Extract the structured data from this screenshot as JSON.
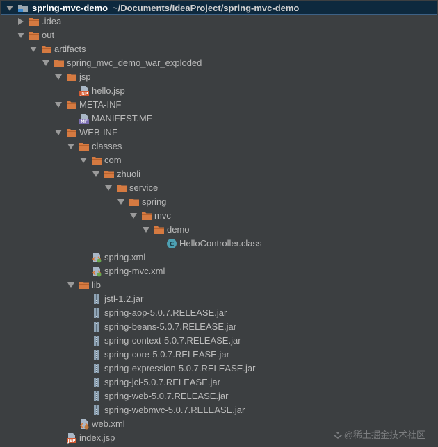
{
  "window_title": "spring-mvc-demo",
  "project_path": "~/Documents/IdeaProject/spring-mvc-demo",
  "watermark": "@稀土掘金技术社区",
  "colors": {
    "background": "#3c3f41",
    "selection": "#0d293e",
    "folder": "#d57a41",
    "jar": "#8fa3b4",
    "class": "#4da0b2",
    "text": "#bbbbbb"
  },
  "tree": [
    {
      "label": ".idea",
      "icon": "folder-icon",
      "toggle": "closed",
      "depth": 1
    },
    {
      "label": "out",
      "icon": "folder-icon",
      "toggle": "open",
      "depth": 1
    },
    {
      "label": "artifacts",
      "icon": "folder-icon",
      "toggle": "open",
      "depth": 2
    },
    {
      "label": "spring_mvc_demo_war_exploded",
      "icon": "folder-icon",
      "toggle": "open",
      "depth": 3
    },
    {
      "label": "jsp",
      "icon": "folder-icon",
      "toggle": "open",
      "depth": 4
    },
    {
      "label": "hello.jsp",
      "icon": "jsp-file-icon",
      "toggle": "none",
      "depth": 5
    },
    {
      "label": "META-INF",
      "icon": "folder-icon",
      "toggle": "open",
      "depth": 4
    },
    {
      "label": "MANIFEST.MF",
      "icon": "manifest-file-icon",
      "toggle": "none",
      "depth": 5
    },
    {
      "label": "WEB-INF",
      "icon": "folder-icon",
      "toggle": "open",
      "depth": 4
    },
    {
      "label": "classes",
      "icon": "folder-icon",
      "toggle": "open",
      "depth": 5
    },
    {
      "label": "com",
      "icon": "folder-icon",
      "toggle": "open",
      "depth": 6
    },
    {
      "label": "zhuoli",
      "icon": "folder-icon",
      "toggle": "open",
      "depth": 7
    },
    {
      "label": "service",
      "icon": "folder-icon",
      "toggle": "open",
      "depth": 8
    },
    {
      "label": "spring",
      "icon": "folder-icon",
      "toggle": "open",
      "depth": 9
    },
    {
      "label": "mvc",
      "icon": "folder-icon",
      "toggle": "open",
      "depth": 10
    },
    {
      "label": "demo",
      "icon": "folder-icon",
      "toggle": "open",
      "depth": 11
    },
    {
      "label": "HelloController.class",
      "icon": "java-class-icon",
      "toggle": "none",
      "depth": 12
    },
    {
      "label": "spring.xml",
      "icon": "spring-xml-icon",
      "toggle": "none",
      "depth": 6
    },
    {
      "label": "spring-mvc.xml",
      "icon": "spring-xml-icon",
      "toggle": "none",
      "depth": 6
    },
    {
      "label": "lib",
      "icon": "folder-icon",
      "toggle": "open",
      "depth": 5
    },
    {
      "label": "jstl-1.2.jar",
      "icon": "jar-icon",
      "toggle": "none",
      "depth": 6
    },
    {
      "label": "spring-aop-5.0.7.RELEASE.jar",
      "icon": "jar-icon",
      "toggle": "none",
      "depth": 6
    },
    {
      "label": "spring-beans-5.0.7.RELEASE.jar",
      "icon": "jar-icon",
      "toggle": "none",
      "depth": 6
    },
    {
      "label": "spring-context-5.0.7.RELEASE.jar",
      "icon": "jar-icon",
      "toggle": "none",
      "depth": 6
    },
    {
      "label": "spring-core-5.0.7.RELEASE.jar",
      "icon": "jar-icon",
      "toggle": "none",
      "depth": 6
    },
    {
      "label": "spring-expression-5.0.7.RELEASE.jar",
      "icon": "jar-icon",
      "toggle": "none",
      "depth": 6
    },
    {
      "label": "spring-jcl-5.0.7.RELEASE.jar",
      "icon": "jar-icon",
      "toggle": "none",
      "depth": 6
    },
    {
      "label": "spring-web-5.0.7.RELEASE.jar",
      "icon": "jar-icon",
      "toggle": "none",
      "depth": 6
    },
    {
      "label": "spring-webmvc-5.0.7.RELEASE.jar",
      "icon": "jar-icon",
      "toggle": "none",
      "depth": 6
    },
    {
      "label": "web.xml",
      "icon": "web-xml-icon",
      "toggle": "none",
      "depth": 5
    },
    {
      "label": "index.jsp",
      "icon": "jsp-file-icon",
      "toggle": "none",
      "depth": 4
    }
  ]
}
